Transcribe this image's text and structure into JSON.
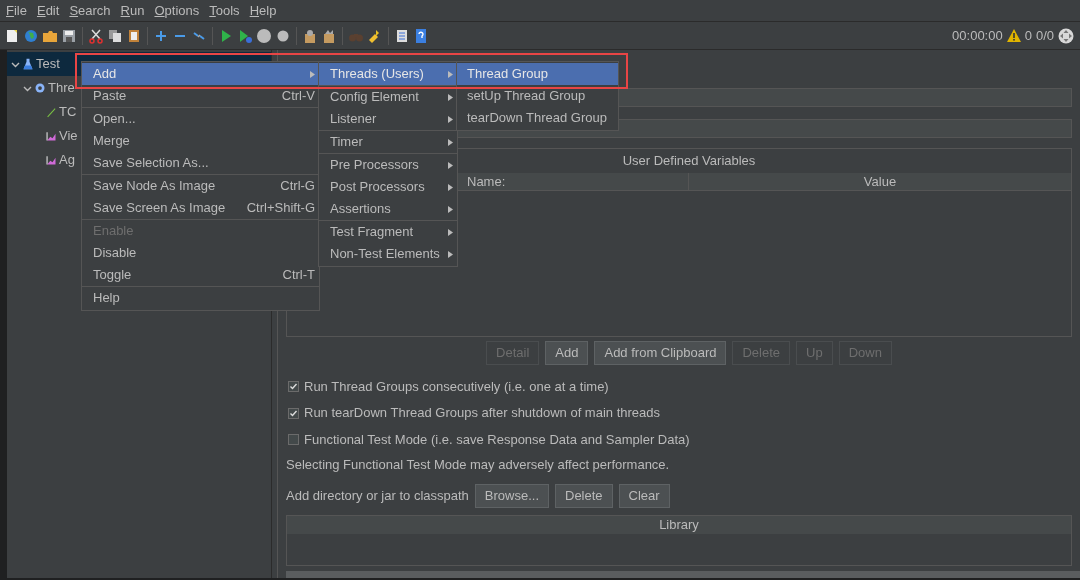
{
  "menubar": [
    {
      "label": "File"
    },
    {
      "label": "Edit"
    },
    {
      "label": "Search"
    },
    {
      "label": "Run"
    },
    {
      "label": "Options"
    },
    {
      "label": "Tools"
    },
    {
      "label": "Help"
    }
  ],
  "status": {
    "elapsed": "00:00:00",
    "warnings": "0",
    "threads": "0/0"
  },
  "tree": [
    {
      "label": "Test",
      "kind": "plan",
      "selected": true,
      "expanded": true,
      "children": [
        {
          "label": "Thre",
          "kind": "threads",
          "selected": false,
          "expanded": true,
          "children": [
            {
              "label": "TC",
              "kind": "sampler",
              "selected": false
            },
            {
              "label": "Vie",
              "kind": "listener",
              "selected": false
            },
            {
              "label": "Ag",
              "kind": "listener",
              "selected": false
            }
          ]
        }
      ]
    }
  ],
  "context_menu": [
    [
      {
        "label": "Add",
        "selected": true,
        "disabled": false,
        "submenu": true
      },
      {
        "label": "Paste",
        "shortcut": "Ctrl-V",
        "selected": false,
        "disabled": false,
        "submenu": false
      }
    ],
    [
      {
        "label": "Open...",
        "selected": false,
        "disabled": false,
        "submenu": false
      },
      {
        "label": "Merge",
        "selected": false,
        "disabled": false,
        "submenu": false
      },
      {
        "label": "Save Selection As...",
        "selected": false,
        "disabled": false,
        "submenu": false
      }
    ],
    [
      {
        "label": "Save Node As Image",
        "shortcut": "Ctrl-G",
        "selected": false,
        "disabled": false,
        "submenu": false
      },
      {
        "label": "Save Screen As Image",
        "shortcut": "Ctrl+Shift-G",
        "selected": false,
        "disabled": false,
        "submenu": false
      }
    ],
    [
      {
        "label": "Enable",
        "selected": false,
        "disabled": true,
        "submenu": false
      },
      {
        "label": "Disable",
        "selected": false,
        "disabled": false,
        "submenu": false
      },
      {
        "label": "Toggle",
        "shortcut": "Ctrl-T",
        "selected": false,
        "disabled": false,
        "submenu": false
      }
    ],
    [
      {
        "label": "Help",
        "selected": false,
        "disabled": false,
        "submenu": false
      }
    ]
  ],
  "add_submenu": [
    [
      {
        "label": "Threads (Users)",
        "selected": true,
        "submenu": true
      }
    ],
    [
      {
        "label": "Config Element",
        "selected": false,
        "submenu": true
      },
      {
        "label": "Listener",
        "selected": false,
        "submenu": true
      }
    ],
    [
      {
        "label": "Timer",
        "selected": false,
        "submenu": true
      }
    ],
    [
      {
        "label": "Pre Processors",
        "selected": false,
        "submenu": true
      },
      {
        "label": "Post Processors",
        "selected": false,
        "submenu": true
      },
      {
        "label": "Assertions",
        "selected": false,
        "submenu": true
      }
    ],
    [
      {
        "label": "Test Fragment",
        "selected": false,
        "submenu": true
      },
      {
        "label": "Non-Test Elements",
        "selected": false,
        "submenu": true
      }
    ]
  ],
  "threads_submenu": [
    {
      "label": "Thread Group",
      "selected": true
    },
    {
      "label": "setUp Thread Group",
      "selected": false
    },
    {
      "label": "tearDown Thread Group",
      "selected": false
    }
  ],
  "variables": {
    "title": "User Defined Variables",
    "columns": [
      "Name:",
      "Value"
    ]
  },
  "variable_buttons": [
    {
      "label": "Detail",
      "disabled": true
    },
    {
      "label": "Add",
      "disabled": false
    },
    {
      "label": "Add from Clipboard",
      "disabled": false
    },
    {
      "label": "Delete",
      "disabled": true
    },
    {
      "label": "Up",
      "disabled": true
    },
    {
      "label": "Down",
      "disabled": true
    }
  ],
  "options": [
    {
      "label": "Run Thread Groups consecutively (i.e. one at a time)",
      "checked": true
    },
    {
      "label": "Run tearDown Thread Groups after shutdown of main threads",
      "checked": true
    },
    {
      "label": "Functional Test Mode (i.e. save Response Data and Sampler Data)",
      "checked": false
    }
  ],
  "note": "Selecting Functional Test Mode may adversely affect performance.",
  "classpath": {
    "label": "Add directory or jar to classpath",
    "buttons": [
      "Browse...",
      "Delete",
      "Clear"
    ],
    "column": "Library"
  }
}
